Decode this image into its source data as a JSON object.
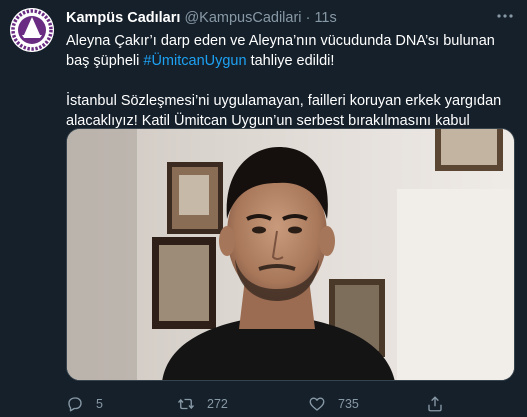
{
  "tweet": {
    "display_name": "Kampüs Cadıları",
    "handle": "@KampusCadilari",
    "separator": "·",
    "time": "11s",
    "line1_text": "Aleyna Çakır’ı darp eden ve Aleyna’nın vücudunda DNA’sı bulunan baş şüpheli ",
    "hashtag": "#ÜmitcanUygun",
    "line1_tail": " tahliye edildi!",
    "paragraph2": "İstanbul Sözleşmesi’ni uygulamayan, failleri koruyan erkek yargıdan alacaklıyız! Katil Ümitcan Uygun’un serbest bırakılmasını kabul etmiyoruz!"
  },
  "actions": {
    "reply_count": "5",
    "retweet_count": "272",
    "like_count": "735"
  },
  "colors": {
    "background": "#15202b",
    "text": "#ffffff",
    "secondary": "#8899a6",
    "link": "#1da1f2",
    "avatar_purple": "#6a2c83"
  },
  "icons": [
    "more-icon",
    "reply-icon",
    "retweet-icon",
    "like-icon",
    "share-icon"
  ]
}
